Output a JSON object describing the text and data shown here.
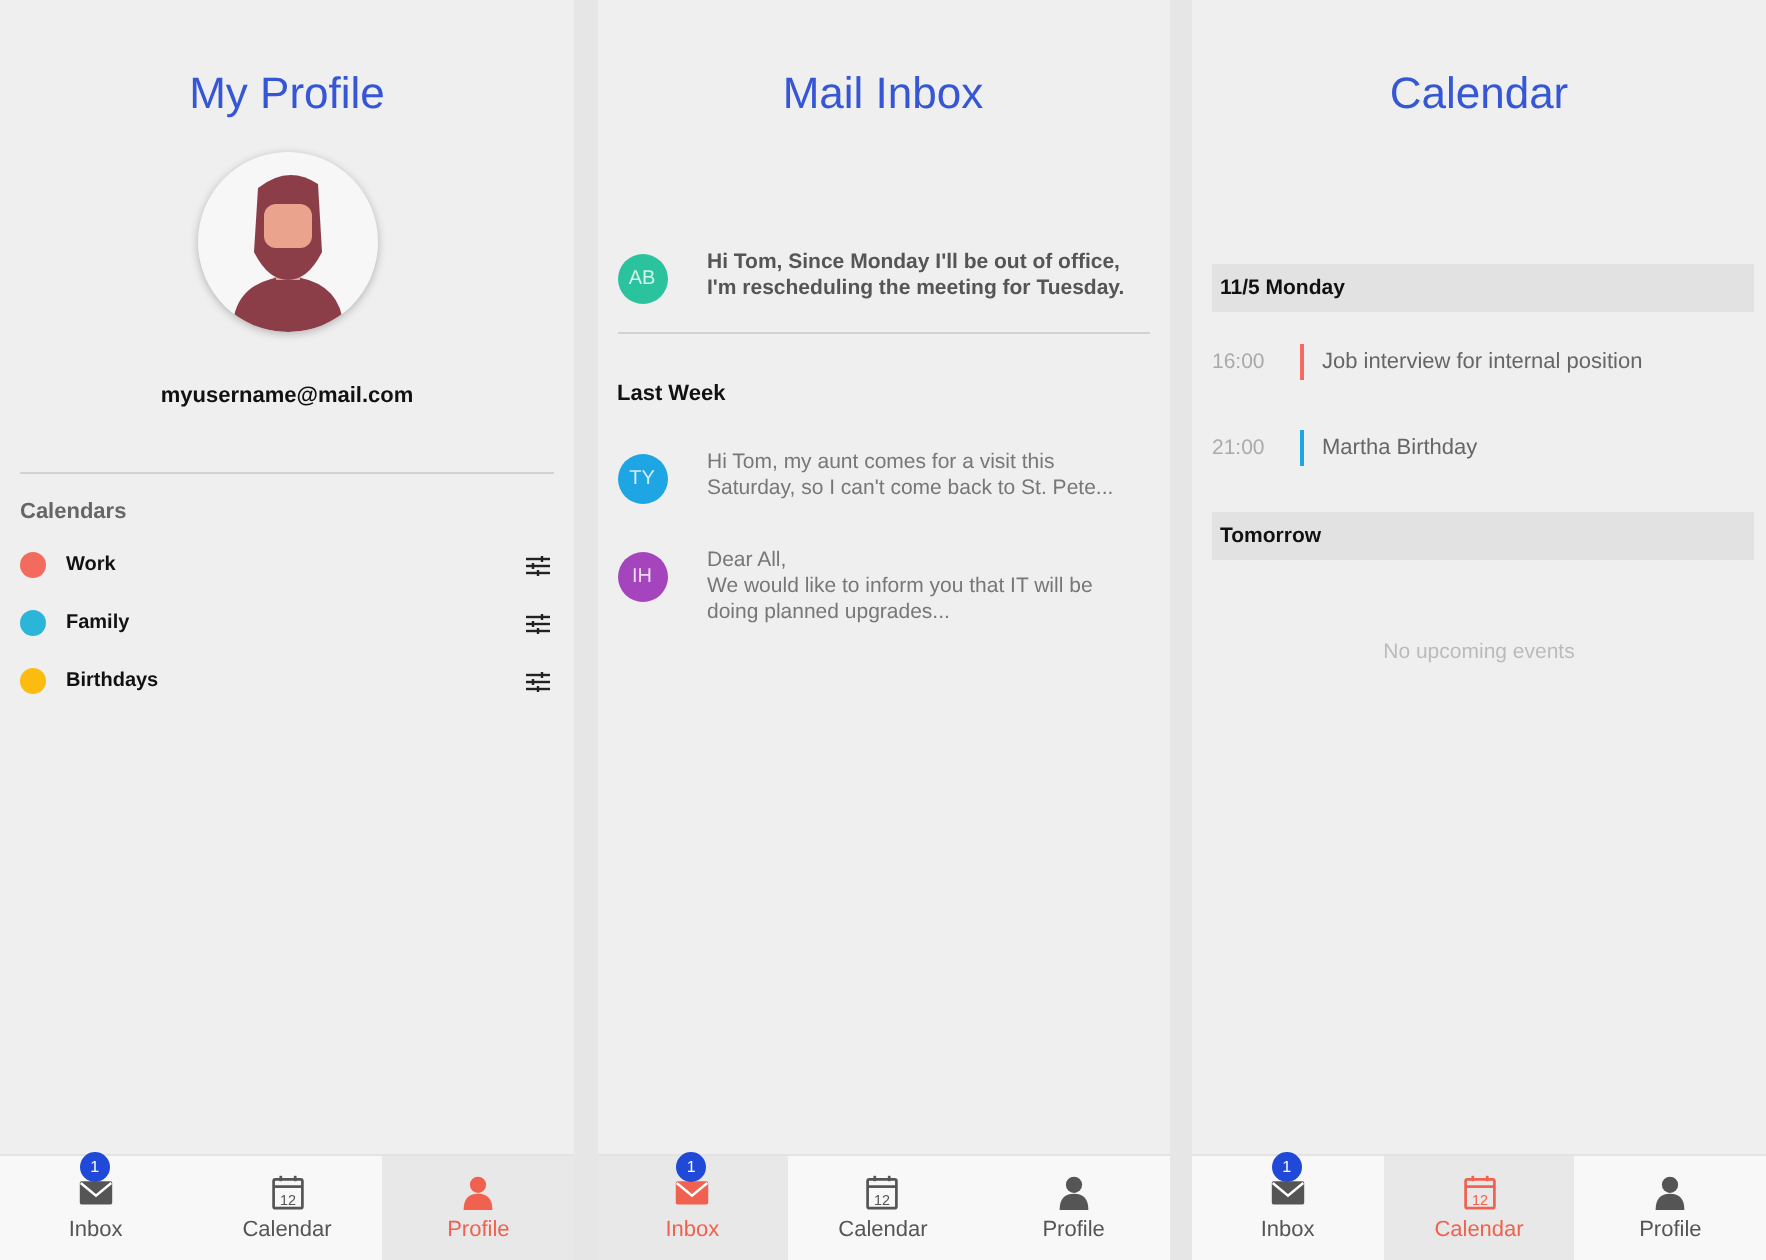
{
  "screens": [
    {
      "kind": "profile",
      "title": "My Profile",
      "email": "myusername@mail.com",
      "section": "Calendars",
      "calendars": [
        {
          "name": "Work",
          "color": "#f26b5e"
        },
        {
          "name": "Family",
          "color": "#2bb5d8"
        },
        {
          "name": "Birthdays",
          "color": "#fbbc0f"
        }
      ],
      "nav": [
        {
          "label": "Inbox",
          "kind": "mail",
          "badge": "1",
          "selected": false
        },
        {
          "label": "Calendar",
          "kind": "calendar",
          "icon_text": "12",
          "selected": false
        },
        {
          "label": "Profile",
          "kind": "person",
          "selected": true
        }
      ]
    },
    {
      "kind": "inbox",
      "title": "Mail Inbox",
      "groups": [
        {
          "messages": [
            {
              "initials": "AB",
              "color": "#2bc39e",
              "unread": true,
              "text": "Hi Tom, Since Monday I'll be out of office,\nI'm rescheduling the meeting for Tuesday."
            }
          ]
        },
        {
          "heading": "Last Week",
          "messages": [
            {
              "initials": "TY",
              "color": "#1ea5e3",
              "unread": false,
              "text": "Hi Tom, my aunt comes for a visit this\nSaturday, so I can't come back to St. Pete..."
            },
            {
              "initials": "IH",
              "color": "#a545bd",
              "unread": false,
              "text": "Dear All,\nWe would like to inform you that IT will be\ndoing planned upgrades..."
            }
          ]
        }
      ],
      "nav": [
        {
          "label": "Inbox",
          "kind": "mail",
          "badge": "1",
          "selected": true
        },
        {
          "label": "Calendar",
          "kind": "calendar",
          "icon_text": "12",
          "selected": false
        },
        {
          "label": "Profile",
          "kind": "person",
          "selected": false
        }
      ]
    },
    {
      "kind": "calendar",
      "title": "Calendar",
      "days": [
        {
          "heading": "11/5 Monday",
          "events": [
            {
              "time": "16:00",
              "title": "Job interview for internal position",
              "color": "#f26b5e"
            },
            {
              "time": "21:00",
              "title": "Martha Birthday",
              "color": "#1ea5e3"
            }
          ]
        },
        {
          "heading": "Tomorrow",
          "empty_text": "No upcoming events"
        }
      ],
      "nav": [
        {
          "label": "Inbox",
          "kind": "mail",
          "badge": "1",
          "selected": false
        },
        {
          "label": "Calendar",
          "kind": "calendar",
          "icon_text": "12",
          "selected": true
        },
        {
          "label": "Profile",
          "kind": "person",
          "selected": false
        }
      ]
    }
  ]
}
